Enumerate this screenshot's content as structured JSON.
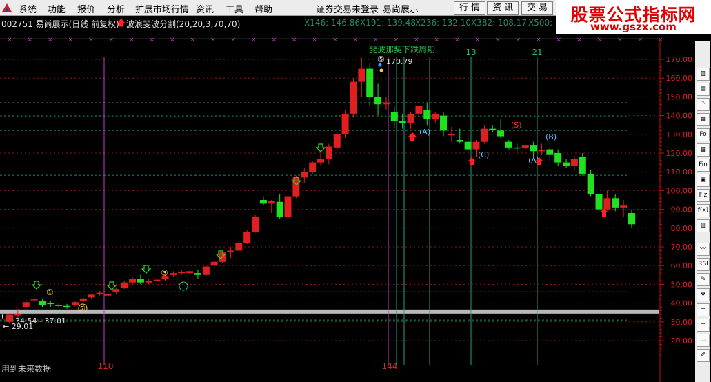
{
  "menubar": {
    "items": [
      "系统",
      "功能",
      "报价",
      "分析",
      "扩展市场行情",
      "资讯",
      "工具",
      "帮助"
    ],
    "status": "证券交易未登录",
    "stock_name": "易尚展示",
    "buttons": [
      "行 情",
      "资 讯",
      "交 易"
    ]
  },
  "watermark": {
    "title": "股票公式指标网",
    "url": "www.gszx.com"
  },
  "infobar": {
    "stock": "002751 易尚展示(日线 前复权)",
    "indicator": "波浪斐波分割(20,20,3,70,70)",
    "readouts": [
      "X146: 146.86",
      "X191: 139.48",
      "X236: 132.10",
      "X382: 108.17",
      "X500:"
    ]
  },
  "chart_data": {
    "type": "candlestick",
    "y_axis_ticks": [
      20,
      30,
      40,
      50,
      60,
      70,
      80,
      90,
      100,
      110,
      120,
      130,
      140,
      150,
      160,
      170
    ],
    "ylim": [
      14,
      178
    ],
    "fib_levels": [
      146.86,
      139.48,
      132.1,
      108.17
    ],
    "vertical_lines": [
      {
        "label": "110",
        "color": "#c040c0"
      },
      {
        "label": "144",
        "color": "#c040c0"
      },
      {
        "label": "",
        "color": "#20a080"
      },
      {
        "label": "",
        "color": "#20a080"
      },
      {
        "label": "13",
        "color": "#20a080"
      },
      {
        "label": "21",
        "color": "#20a080"
      }
    ],
    "cycle_title": "斐波那契下跌周期",
    "high_label": "170.79",
    "low_labels": [
      "34.54 - 37.01",
      "← 29.01"
    ],
    "wave_labels_up": [
      "①",
      "③",
      "⑤",
      "⑤"
    ],
    "wave_labels_down": [
      "(A)",
      "(C)",
      "(A)",
      "(B)",
      "(S)"
    ],
    "footer_note": "用到未来数据",
    "candles": [
      [
        30.0,
        34.5,
        29.0,
        33.8
      ],
      [
        33.8,
        37.0,
        32.0,
        34.0
      ],
      [
        38.0,
        42.0,
        37.5,
        40.5
      ],
      [
        41.5,
        45.0,
        40.0,
        42.0
      ],
      [
        41.0,
        42.0,
        38.0,
        39.0
      ],
      [
        40.0,
        41.0,
        38.0,
        39.5
      ],
      [
        39.0,
        40.0,
        37.8,
        38.5
      ],
      [
        38.5,
        39.5,
        37.0,
        38.0
      ],
      [
        39.0,
        41.0,
        38.2,
        40.5
      ],
      [
        41.0,
        43.0,
        40.0,
        42.5
      ],
      [
        43.0,
        45.0,
        42.0,
        44.5
      ],
      [
        45.0,
        46.5,
        44.0,
        45.5
      ],
      [
        44.0,
        46.0,
        43.0,
        45.0
      ],
      [
        46.0,
        48.0,
        45.0,
        47.5
      ],
      [
        48.0,
        52.0,
        47.5,
        51.0
      ],
      [
        51.0,
        54.0,
        50.0,
        53.0
      ],
      [
        53.0,
        55.0,
        50.0,
        51.0
      ],
      [
        51.0,
        53.0,
        50.0,
        52.0
      ],
      [
        52.0,
        53.5,
        51.0,
        52.5
      ],
      [
        53.0,
        55.0,
        52.0,
        54.5
      ],
      [
        55.0,
        57.0,
        54.0,
        56.0
      ],
      [
        56.0,
        57.5,
        55.0,
        56.5
      ],
      [
        56.0,
        57.5,
        55.5,
        57.0
      ],
      [
        56.0,
        58.0,
        53.0,
        55.0
      ],
      [
        55.0,
        60.0,
        54.5,
        59.5
      ],
      [
        60.0,
        63.0,
        59.0,
        62.0
      ],
      [
        62.0,
        68.0,
        61.5,
        67.0
      ],
      [
        67.0,
        70.0,
        64.0,
        68.0
      ],
      [
        68.0,
        73.0,
        67.0,
        72.0
      ],
      [
        72.0,
        79.0,
        71.5,
        78.0
      ],
      [
        78.0,
        87.0,
        77.5,
        86.0
      ],
      [
        95.0,
        97.0,
        92.0,
        93.0
      ],
      [
        93.0,
        95.0,
        88.0,
        94.5
      ],
      [
        94.0,
        98.0,
        85.0,
        86.0
      ],
      [
        86.0,
        99.0,
        85.5,
        97.0
      ],
      [
        97.0,
        108.0,
        96.0,
        107.0
      ],
      [
        107.0,
        112.0,
        104.0,
        110.0
      ],
      [
        110.0,
        116.0,
        109.0,
        115.0
      ],
      [
        115.0,
        121.0,
        113.0,
        117.0
      ],
      [
        117.0,
        125.0,
        114.0,
        123.5
      ],
      [
        123.0,
        131.0,
        121.0,
        130.0
      ],
      [
        130.0,
        143.0,
        128.0,
        141.0
      ],
      [
        141.0,
        160.0,
        139.0,
        158.0
      ],
      [
        158.0,
        170.8,
        150.0,
        165.0
      ],
      [
        165.0,
        168.0,
        145.0,
        150.0
      ],
      [
        150.0,
        157.0,
        140.0,
        146.0
      ],
      [
        146.0,
        150.0,
        143.0,
        147.0
      ],
      [
        142.0,
        145.0,
        133.0,
        137.0
      ],
      [
        137.0,
        141.0,
        133.0,
        136.0
      ],
      [
        136.0,
        142.0,
        133.0,
        141.0
      ],
      [
        141.0,
        150.0,
        140.0,
        145.0
      ],
      [
        143.0,
        147.0,
        135.0,
        138.0
      ],
      [
        138.0,
        142.0,
        136.0,
        141.0
      ],
      [
        140.0,
        142.0,
        129.0,
        132.0
      ],
      [
        130.0,
        134.0,
        126.0,
        130.0
      ],
      [
        127.0,
        133.0,
        125.0,
        126.0
      ],
      [
        126.0,
        130.0,
        120.0,
        122.0
      ],
      [
        122.0,
        127.0,
        118.0,
        126.0
      ],
      [
        126.0,
        135.0,
        125.0,
        133.0
      ],
      [
        133.0,
        135.0,
        131.0,
        132.5
      ],
      [
        132.0,
        138.0,
        128.0,
        129.0
      ],
      [
        126.0,
        127.0,
        122.0,
        123.0
      ],
      [
        123.0,
        125.0,
        121.0,
        122.5
      ],
      [
        122.5,
        125.0,
        121.0,
        124.0
      ],
      [
        124.0,
        126.0,
        118.0,
        121.0
      ],
      [
        121.0,
        125.0,
        119.0,
        121.5
      ],
      [
        122.0,
        123.0,
        116.0,
        119.0
      ],
      [
        120.0,
        122.0,
        113.0,
        115.0
      ],
      [
        115.0,
        117.0,
        112.0,
        113.0
      ],
      [
        113.0,
        118.0,
        111.0,
        117.0
      ],
      [
        118.0,
        120.0,
        108.0,
        109.0
      ],
      [
        109.0,
        111.0,
        97.0,
        98.0
      ],
      [
        98.0,
        100.0,
        89.0,
        90.0
      ],
      [
        90.0,
        100.0,
        89.5,
        96.0
      ],
      [
        96.0,
        98.0,
        89.0,
        91.0
      ],
      [
        91.0,
        95.0,
        86.0,
        92.0
      ],
      [
        88.0,
        90.0,
        80.0,
        82.0
      ]
    ]
  }
}
